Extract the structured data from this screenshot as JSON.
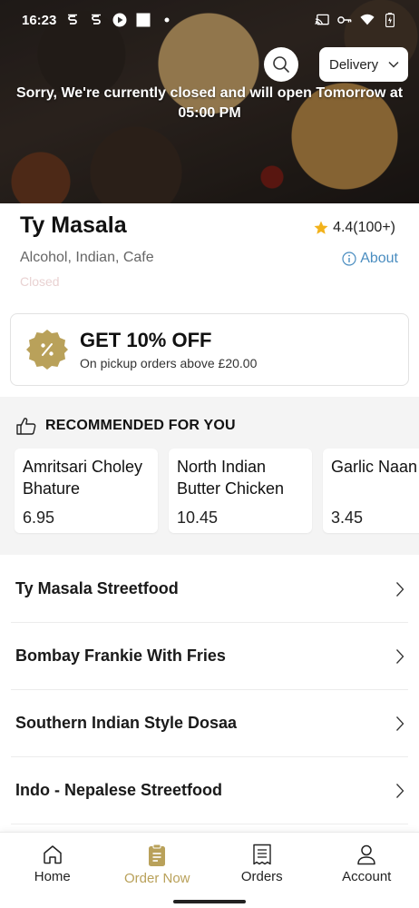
{
  "status_bar": {
    "time": "16:23",
    "left_icons": [
      "s-icon",
      "s-icon",
      "play-icon",
      "square-icon",
      "dot-icon"
    ],
    "right_icons": [
      "cast-icon",
      "key-icon",
      "wifi-icon",
      "battery-icon"
    ]
  },
  "hero": {
    "closed_message_line1": "Sorry, We're currently closed and will open Tomorrow at",
    "closed_message_line2": "05:00 PM",
    "delivery_mode": "Delivery"
  },
  "restaurant": {
    "name": "Ty Masala",
    "cuisines": "Alcohol, Indian, Cafe",
    "status": "Closed",
    "rating": "4.4(100+)",
    "about_label": "About"
  },
  "offer": {
    "title": "GET 10% OFF",
    "subtitle": "On pickup orders above £20.00",
    "badge_color": "#b9a15a"
  },
  "recommended": {
    "heading": "RECOMMENDED FOR YOU",
    "items": [
      {
        "name": "Amritsari Choley Bhature",
        "price": "6.95"
      },
      {
        "name": "North Indian Butter Chicken",
        "price": "10.45"
      },
      {
        "name": "Garlic Naan",
        "price": "3.45"
      }
    ]
  },
  "categories": [
    {
      "label": "Ty Masala Streetfood"
    },
    {
      "label": "Bombay Frankie With Fries"
    },
    {
      "label": "Southern Indian Style Dosaa"
    },
    {
      "label": "Indo - Nepalese Streetfood"
    }
  ],
  "bottom_nav": [
    {
      "label": "Home",
      "icon": "home-icon"
    },
    {
      "label": "Order Now",
      "icon": "order-icon"
    },
    {
      "label": "Orders",
      "icon": "receipt-icon"
    },
    {
      "label": "Account",
      "icon": "user-icon"
    }
  ],
  "colors": {
    "accent": "#b9a15a",
    "link": "#4a8dc0",
    "star": "#f2b21b"
  }
}
